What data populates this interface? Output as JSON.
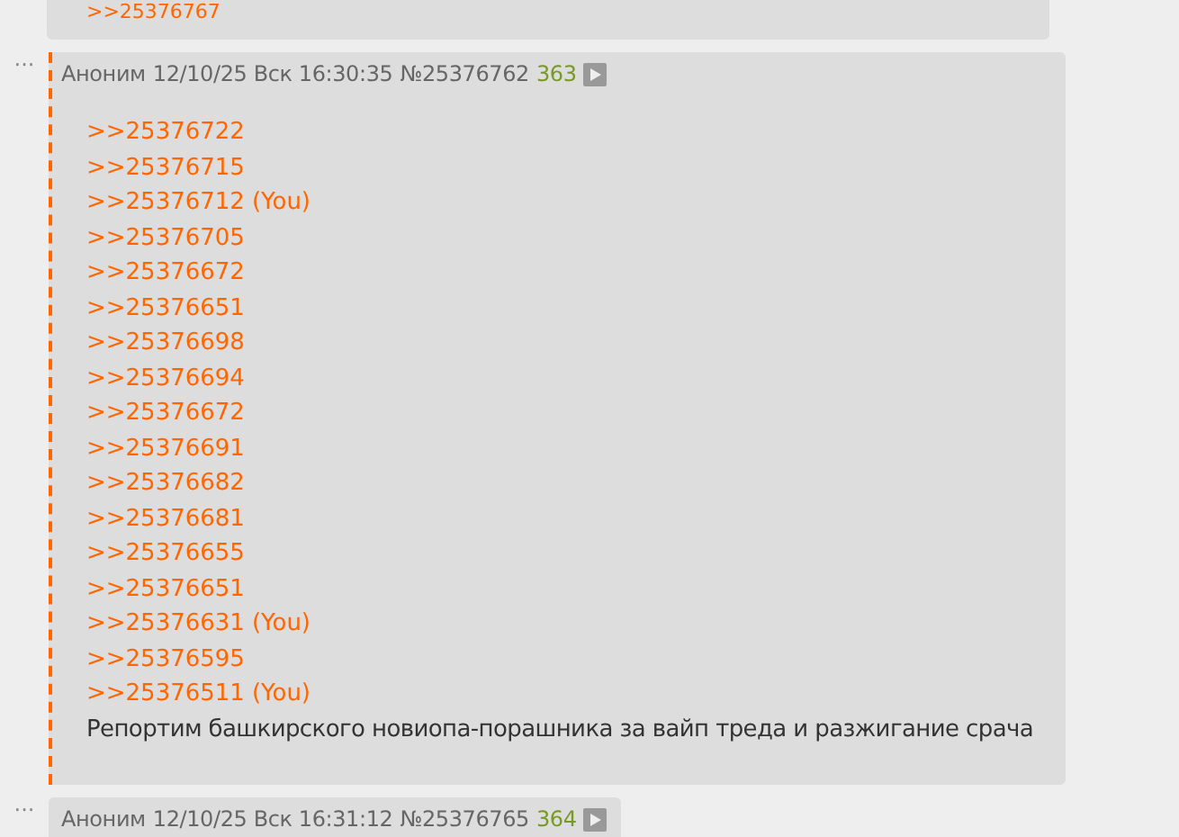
{
  "posts": [
    {
      "kind": "partial",
      "links": [
        {
          "text": ">>25376767"
        }
      ]
    },
    {
      "kind": "post",
      "highlighted": true,
      "menu": "···",
      "name": "Аноним",
      "date": "12/10/25 Вск 16:30:35",
      "number": "№25376762",
      "count": "363",
      "links": [
        {
          "text": ">>25376722"
        },
        {
          "text": ">>25376715"
        },
        {
          "text": ">>25376712",
          "suffix": "(You)"
        },
        {
          "text": ">>25376705"
        },
        {
          "text": ">>25376672"
        },
        {
          "text": ">>25376651"
        },
        {
          "text": ">>25376698"
        },
        {
          "text": ">>25376694"
        },
        {
          "text": ">>25376672"
        },
        {
          "text": ">>25376691"
        },
        {
          "text": ">>25376682"
        },
        {
          "text": ">>25376681"
        },
        {
          "text": ">>25376655"
        },
        {
          "text": ">>25376651"
        },
        {
          "text": ">>25376631",
          "suffix": "(You)"
        },
        {
          "text": ">>25376595"
        },
        {
          "text": ">>25376511",
          "suffix": "(You)"
        }
      ],
      "body": "Репортим башкирского новиопа-порашника за вайп треда и разжигание срача"
    },
    {
      "kind": "post",
      "highlighted": false,
      "menu": "···",
      "name": "Аноним",
      "date": "12/10/25 Вск 16:31:12",
      "number": "№25376765",
      "count": "364"
    }
  ]
}
